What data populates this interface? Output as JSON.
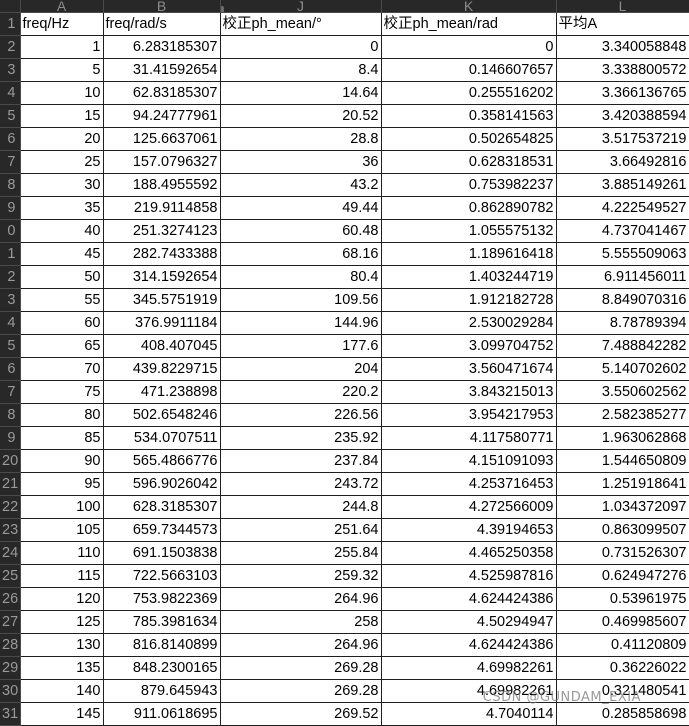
{
  "columns": [
    "A",
    "B",
    "J",
    "K",
    "L"
  ],
  "header_row": {
    "row_number": "1",
    "cells": [
      "freq/Hz",
      "freq/rad/s",
      "校正ph_mean/°",
      "校正ph_mean/rad",
      "平均A"
    ]
  },
  "rows": [
    {
      "n": "2",
      "a": "1",
      "b": "6.283185307",
      "j": "0",
      "k": "0",
      "l": "3.340058848"
    },
    {
      "n": "3",
      "a": "5",
      "b": "31.41592654",
      "j": "8.4",
      "k": "0.146607657",
      "l": "3.338800572"
    },
    {
      "n": "4",
      "a": "10",
      "b": "62.83185307",
      "j": "14.64",
      "k": "0.255516202",
      "l": "3.366136765"
    },
    {
      "n": "5",
      "a": "15",
      "b": "94.24777961",
      "j": "20.52",
      "k": "0.358141563",
      "l": "3.420388594"
    },
    {
      "n": "6",
      "a": "20",
      "b": "125.6637061",
      "j": "28.8",
      "k": "0.502654825",
      "l": "3.517537219"
    },
    {
      "n": "7",
      "a": "25",
      "b": "157.0796327",
      "j": "36",
      "k": "0.628318531",
      "l": "3.66492816"
    },
    {
      "n": "8",
      "a": "30",
      "b": "188.4955592",
      "j": "43.2",
      "k": "0.753982237",
      "l": "3.885149261"
    },
    {
      "n": "9",
      "a": "35",
      "b": "219.9114858",
      "j": "49.44",
      "k": "0.862890782",
      "l": "4.222549527"
    },
    {
      "n": "0",
      "a": "40",
      "b": "251.3274123",
      "j": "60.48",
      "k": "1.055575132",
      "l": "4.737041467"
    },
    {
      "n": "1",
      "a": "45",
      "b": "282.7433388",
      "j": "68.16",
      "k": "1.189616418",
      "l": "5.555509063"
    },
    {
      "n": "2",
      "a": "50",
      "b": "314.1592654",
      "j": "80.4",
      "k": "1.403244719",
      "l": "6.911456011"
    },
    {
      "n": "3",
      "a": "55",
      "b": "345.5751919",
      "j": "109.56",
      "k": "1.912182728",
      "l": "8.849070316"
    },
    {
      "n": "4",
      "a": "60",
      "b": "376.9911184",
      "j": "144.96",
      "k": "2.530029284",
      "l": "8.78789394"
    },
    {
      "n": "5",
      "a": "65",
      "b": "408.407045",
      "j": "177.6",
      "k": "3.099704752",
      "l": "7.488842282"
    },
    {
      "n": "6",
      "a": "70",
      "b": "439.8229715",
      "j": "204",
      "k": "3.560471674",
      "l": "5.140702602"
    },
    {
      "n": "7",
      "a": "75",
      "b": "471.238898",
      "j": "220.2",
      "k": "3.843215013",
      "l": "3.550602562"
    },
    {
      "n": "8",
      "a": "80",
      "b": "502.6548246",
      "j": "226.56",
      "k": "3.954217953",
      "l": "2.582385277"
    },
    {
      "n": "9",
      "a": "85",
      "b": "534.0707511",
      "j": "235.92",
      "k": "4.117580771",
      "l": "1.963062868"
    },
    {
      "n": "20",
      "a": "90",
      "b": "565.4866776",
      "j": "237.84",
      "k": "4.151091093",
      "l": "1.544650809"
    },
    {
      "n": "21",
      "a": "95",
      "b": "596.9026042",
      "j": "243.72",
      "k": "4.253716453",
      "l": "1.251918641"
    },
    {
      "n": "22",
      "a": "100",
      "b": "628.3185307",
      "j": "244.8",
      "k": "4.272566009",
      "l": "1.034372097"
    },
    {
      "n": "23",
      "a": "105",
      "b": "659.7344573",
      "j": "251.64",
      "k": "4.39194653",
      "l": "0.863099507"
    },
    {
      "n": "24",
      "a": "110",
      "b": "691.1503838",
      "j": "255.84",
      "k": "4.465250358",
      "l": "0.731526307"
    },
    {
      "n": "25",
      "a": "115",
      "b": "722.5663103",
      "j": "259.32",
      "k": "4.525987816",
      "l": "0.624947276"
    },
    {
      "n": "26",
      "a": "120",
      "b": "753.9822369",
      "j": "264.96",
      "k": "4.624424386",
      "l": "0.53961975"
    },
    {
      "n": "27",
      "a": "125",
      "b": "785.3981634",
      "j": "258",
      "k": "4.50294947",
      "l": "0.469985607"
    },
    {
      "n": "28",
      "a": "130",
      "b": "816.8140899",
      "j": "264.96",
      "k": "4.624424386",
      "l": "0.41120809"
    },
    {
      "n": "29",
      "a": "135",
      "b": "848.2300165",
      "j": "269.28",
      "k": "4.69982261",
      "l": "0.36226022"
    },
    {
      "n": "30",
      "a": "140",
      "b": "879.645943",
      "j": "269.28",
      "k": "4.69982261",
      "l": "0.321480541"
    },
    {
      "n": "31",
      "a": "145",
      "b": "911.0618695",
      "j": "269.52",
      "k": "4.7040114",
      "l": "0.285858698"
    }
  ],
  "watermark": "CSDN @GUNDAM_EXIA",
  "colors": {
    "header_bg": "#282828",
    "header_text": "#8c8c8c",
    "grid_line": "#1f1f1f",
    "cell_bg": "#ffffff"
  }
}
